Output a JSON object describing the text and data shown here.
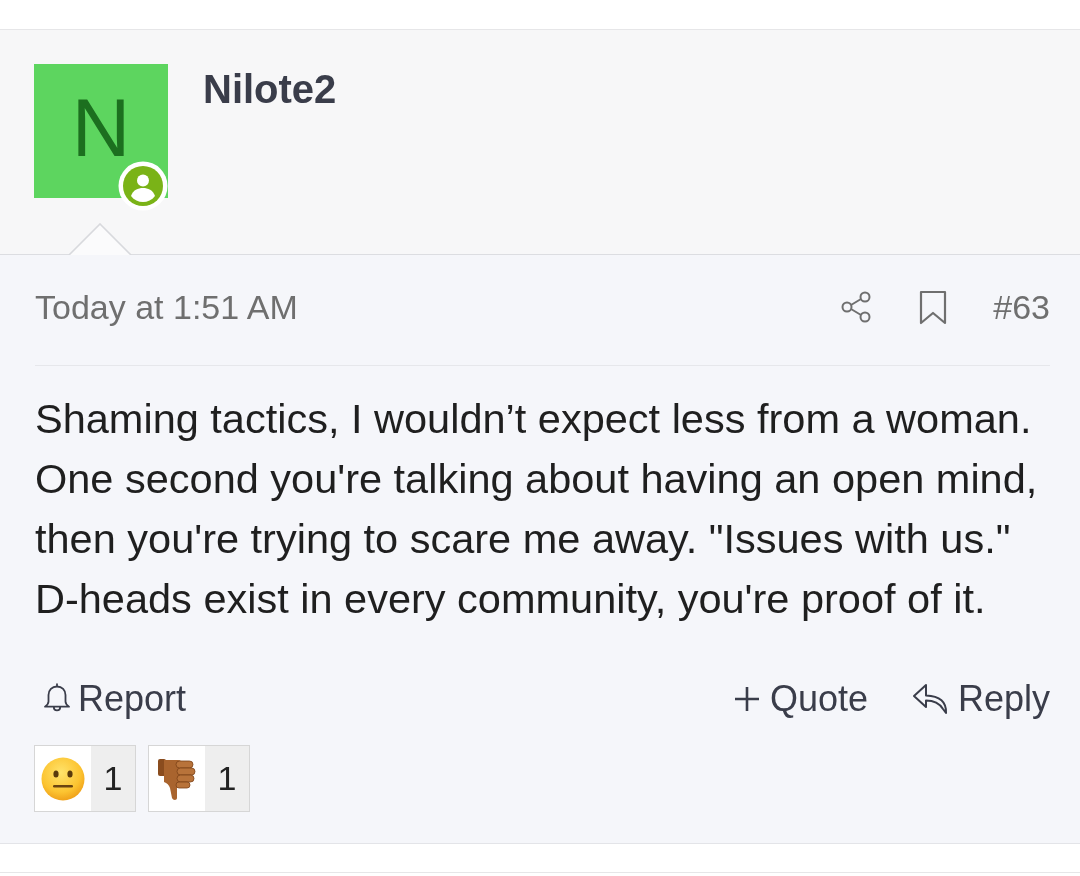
{
  "author": {
    "name": "Nilote2",
    "avatar_letter": "N"
  },
  "post": {
    "time": "Today at 1:51 AM",
    "number": "#63",
    "bookmarked": false,
    "body": "Shaming tactics, I wouldn’t expect less from a woman. One second you're talking about having an open mind, then you're trying to scare me away. \"Issues with us.\" D-heads exist in every community, you're proof of it."
  },
  "actions": [
    {
      "kind": "report",
      "label": "Report"
    },
    {
      "kind": "quote",
      "label": "Quote"
    },
    {
      "kind": "reply",
      "label": "Reply"
    }
  ],
  "reactions": [
    {
      "kind": "neutral-face",
      "count": "1"
    },
    {
      "kind": "thumbs-down",
      "count": "1"
    }
  ]
}
